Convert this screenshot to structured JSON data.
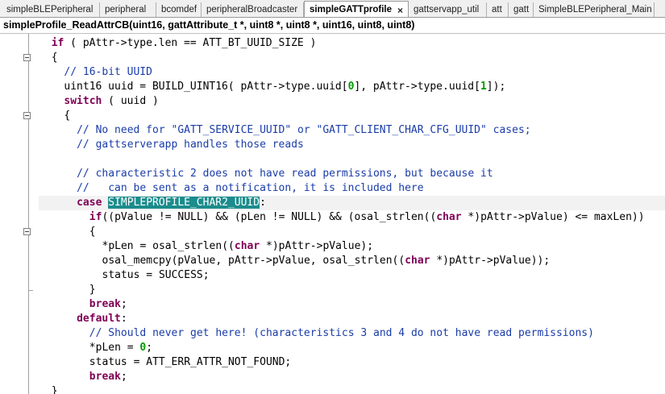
{
  "tabs": [
    {
      "label": "simpleBLEPeripheral",
      "active": false
    },
    {
      "label": "peripheral",
      "active": false
    },
    {
      "label": "bcomdef",
      "active": false
    },
    {
      "label": "peripheralBroadcaster",
      "active": false
    },
    {
      "label": "simpleGATTprofile",
      "active": true
    },
    {
      "label": "gattservapp_util",
      "active": false
    },
    {
      "label": "att",
      "active": false
    },
    {
      "label": "gatt",
      "active": false
    },
    {
      "label": "SimpleBLEPeripheral_Main",
      "active": false
    }
  ],
  "tab_close_glyph": "×",
  "function_signature": "simpleProfile_ReadAttrCB(uint16, gattAttribute_t *, uint8 *, uint8 *, uint16, uint8, uint8)",
  "colors": {
    "keyword": "#7f0055",
    "comment": "#1a3ca8",
    "number": "#009900",
    "selection": "#1c8c8c"
  },
  "code_lines": [
    {
      "indent": 2,
      "tokens": [
        [
          "kw",
          "if"
        ],
        [
          "t",
          " ( pAttr->type.len == ATT_BT_UUID_SIZE )"
        ]
      ]
    },
    {
      "indent": 2,
      "tokens": [
        [
          "t",
          "{"
        ]
      ]
    },
    {
      "indent": 4,
      "tokens": [
        [
          "cm",
          "// 16-bit UUID"
        ]
      ]
    },
    {
      "indent": 4,
      "tokens": [
        [
          "t",
          "uint16 uuid = BUILD_UINT16( pAttr->type.uuid["
        ],
        [
          "num",
          "0"
        ],
        [
          "t",
          "], pAttr->type.uuid["
        ],
        [
          "num",
          "1"
        ],
        [
          "t",
          "]);"
        ]
      ]
    },
    {
      "indent": 4,
      "tokens": [
        [
          "kw",
          "switch"
        ],
        [
          "t",
          " ( uuid )"
        ]
      ]
    },
    {
      "indent": 4,
      "tokens": [
        [
          "t",
          "{"
        ]
      ]
    },
    {
      "indent": 6,
      "tokens": [
        [
          "cm",
          "// No need for \"GATT_SERVICE_UUID\" or \"GATT_CLIENT_CHAR_CFG_UUID\" cases;"
        ]
      ]
    },
    {
      "indent": 6,
      "tokens": [
        [
          "cm",
          "// gattserverapp handles those reads"
        ]
      ]
    },
    {
      "indent": 0,
      "tokens": []
    },
    {
      "indent": 6,
      "tokens": [
        [
          "cm",
          "// characteristic 2 does not have read permissions, but because it"
        ]
      ]
    },
    {
      "indent": 6,
      "tokens": [
        [
          "cm",
          "//   can be sent as a notification, it is included here"
        ]
      ]
    },
    {
      "indent": 6,
      "current": true,
      "tokens": [
        [
          "kw",
          "case"
        ],
        [
          "t",
          " "
        ],
        [
          "sel",
          "SIMPLEPROFILE_CHAR2_UUID"
        ],
        [
          "t",
          ":"
        ]
      ]
    },
    {
      "indent": 8,
      "tokens": [
        [
          "kw",
          "if"
        ],
        [
          "t",
          "((pValue != NULL) && (pLen != NULL) && (osal_strlen(("
        ],
        [
          "kw",
          "char"
        ],
        [
          "t",
          " *)pAttr->pValue) <= maxLen))"
        ]
      ]
    },
    {
      "indent": 8,
      "tokens": [
        [
          "t",
          "{"
        ]
      ]
    },
    {
      "indent": 10,
      "tokens": [
        [
          "t",
          "*pLen = osal_strlen(("
        ],
        [
          "kw",
          "char"
        ],
        [
          "t",
          " *)pAttr->pValue);"
        ]
      ]
    },
    {
      "indent": 10,
      "tokens": [
        [
          "t",
          "osal_memcpy(pValue, pAttr->pValue, osal_strlen(("
        ],
        [
          "kw",
          "char"
        ],
        [
          "t",
          " *)pAttr->pValue));"
        ]
      ]
    },
    {
      "indent": 10,
      "tokens": [
        [
          "t",
          "status = SUCCESS;"
        ]
      ]
    },
    {
      "indent": 8,
      "tokens": [
        [
          "t",
          "}"
        ]
      ]
    },
    {
      "indent": 8,
      "tokens": [
        [
          "kw",
          "break"
        ],
        [
          "t",
          ";"
        ]
      ]
    },
    {
      "indent": 6,
      "tokens": [
        [
          "kw",
          "default"
        ],
        [
          "t",
          ":"
        ]
      ]
    },
    {
      "indent": 8,
      "tokens": [
        [
          "cm",
          "// Should never get here! (characteristics 3 and 4 do not have read permissions)"
        ]
      ]
    },
    {
      "indent": 8,
      "tokens": [
        [
          "t",
          "*pLen = "
        ],
        [
          "num",
          "0"
        ],
        [
          "t",
          ";"
        ]
      ]
    },
    {
      "indent": 8,
      "tokens": [
        [
          "t",
          "status = ATT_ERR_ATTR_NOT_FOUND;"
        ]
      ]
    },
    {
      "indent": 8,
      "tokens": [
        [
          "kw",
          "break"
        ],
        [
          "t",
          ";"
        ]
      ]
    },
    {
      "indent": 2,
      "tokens": [
        [
          "t",
          "}"
        ]
      ]
    }
  ]
}
